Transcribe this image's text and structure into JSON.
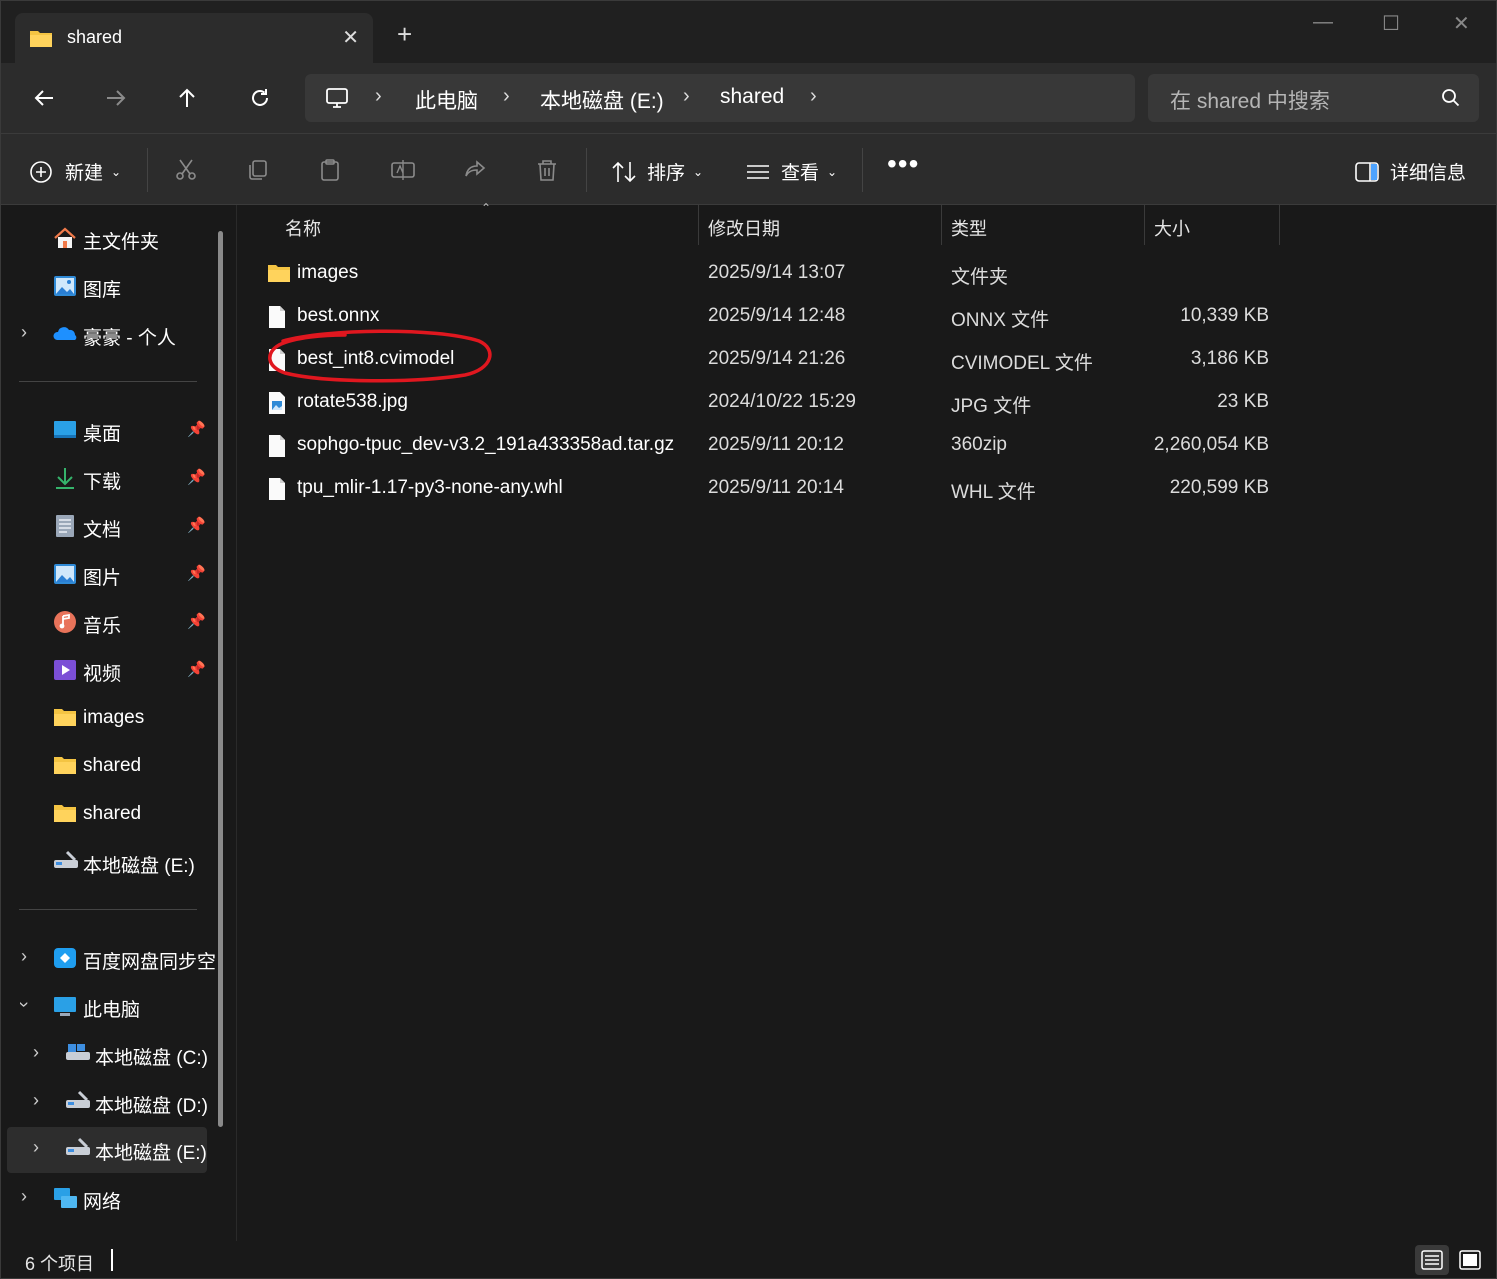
{
  "tab": {
    "title": "shared"
  },
  "address": {
    "segments": [
      "此电脑",
      "本地磁盘 (E:)",
      "shared"
    ]
  },
  "search": {
    "placeholder": "在 shared 中搜索"
  },
  "toolbar": {
    "new_label": "新建",
    "sort_label": "排序",
    "view_label": "查看",
    "details_label": "详细信息"
  },
  "sidebar": {
    "top_items": [
      {
        "label": "主文件夹",
        "icon": "home-icon"
      },
      {
        "label": "图库",
        "icon": "gallery-icon"
      },
      {
        "label": "豪豪 - 个人",
        "icon": "onedrive-icon"
      }
    ],
    "quick_access": [
      {
        "label": "桌面",
        "icon": "desktop-icon",
        "pinned": true
      },
      {
        "label": "下载",
        "icon": "download-icon",
        "pinned": true
      },
      {
        "label": "文档",
        "icon": "document-icon",
        "pinned": true
      },
      {
        "label": "图片",
        "icon": "pictures-icon",
        "pinned": true
      },
      {
        "label": "音乐",
        "icon": "music-icon",
        "pinned": true
      },
      {
        "label": "视频",
        "icon": "video-icon",
        "pinned": true
      },
      {
        "label": "images",
        "icon": "folder-icon",
        "pinned": false
      },
      {
        "label": "shared",
        "icon": "folder-icon",
        "pinned": false
      },
      {
        "label": "shared",
        "icon": "folder-icon",
        "pinned": false
      },
      {
        "label": "本地磁盘 (E:)",
        "icon": "drive-icon",
        "pinned": false
      }
    ],
    "tree": [
      {
        "label": "百度网盘同步空",
        "icon": "baidu-netdisk-icon"
      },
      {
        "label": "此电脑",
        "icon": "this-pc-icon"
      },
      {
        "label": "本地磁盘 (C:)",
        "icon": "drive-icon"
      },
      {
        "label": "本地磁盘 (D:)",
        "icon": "drive-icon"
      },
      {
        "label": "本地磁盘 (E:)",
        "icon": "drive-icon"
      },
      {
        "label": "网络",
        "icon": "network-icon"
      }
    ]
  },
  "columns": {
    "name": "名称",
    "date": "修改日期",
    "type": "类型",
    "size": "大小"
  },
  "files": [
    {
      "name": "images",
      "date": "2025/9/14 13:07",
      "type": "文件夹",
      "size": "",
      "icon": "folder-icon"
    },
    {
      "name": "best.onnx",
      "date": "2025/9/14 12:48",
      "type": "ONNX 文件",
      "size": "10,339 KB",
      "icon": "file-icon"
    },
    {
      "name": "best_int8.cvimodel",
      "date": "2025/9/14 21:26",
      "type": "CVIMODEL 文件",
      "size": "3,186 KB",
      "icon": "file-icon"
    },
    {
      "name": "rotate538.jpg",
      "date": "2024/10/22 15:29",
      "type": "JPG 文件",
      "size": "23 KB",
      "icon": "image-file-icon"
    },
    {
      "name": "sophgo-tpuc_dev-v3.2_191a433358ad.tar.gz",
      "date": "2025/9/11 20:12",
      "type": "360zip",
      "size": "2,260,054 KB",
      "icon": "file-icon"
    },
    {
      "name": "tpu_mlir-1.17-py3-none-any.whl",
      "date": "2025/9/11 20:14",
      "type": "WHL 文件",
      "size": "220,599 KB",
      "icon": "file-icon"
    }
  ],
  "status": {
    "count": "6 个项目"
  },
  "colors": {
    "background": "#191919",
    "panel": "#2c2c2c",
    "folder": "#f4c443",
    "annotation": "#e0171f"
  }
}
